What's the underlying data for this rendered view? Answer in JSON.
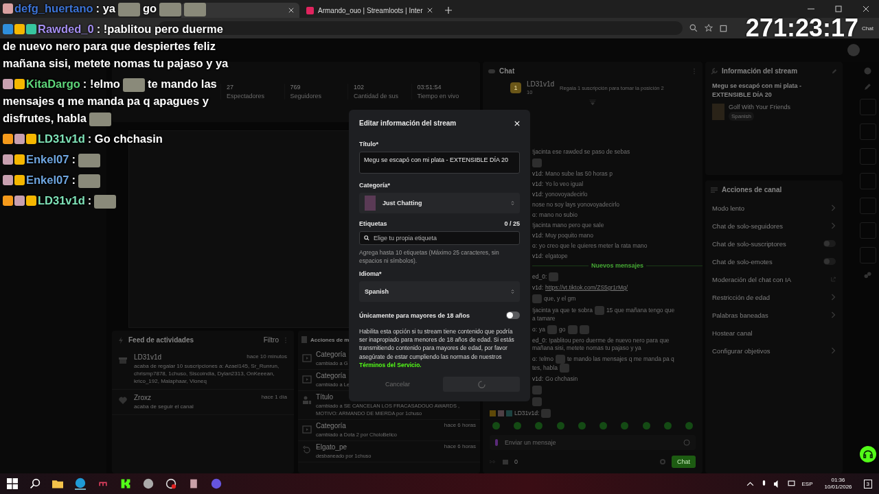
{
  "browser": {
    "tabs": [
      {
        "kind": "kick",
        "selected": true
      },
      {
        "kind": "loots",
        "title": "Armando_ouo | Streamloots | Inter",
        "selected": false
      }
    ],
    "extension_label": "Chat"
  },
  "overlay": {
    "timer": "271:23:17",
    "messages": [
      {
        "user": "defg_huertano",
        "color": "#3d74d6",
        "badges": [
          {
            "kind": "avatar"
          }
        ],
        "parts": [
          {
            "kind": "text",
            "text": ": ya"
          },
          {
            "kind": "emote"
          },
          {
            "kind": "text",
            "text": "go"
          },
          {
            "kind": "emote"
          },
          {
            "kind": "emote"
          }
        ]
      },
      {
        "user": "Rawded_0",
        "color": "#a48ef0",
        "badges": [
          {
            "kind": "hammer"
          },
          {
            "kind": "sub"
          },
          {
            "kind": "gg"
          }
        ],
        "parts": [
          {
            "kind": "text",
            "text": ": !pablitou pero duerme"
          },
          {
            "kind": "text",
            "text": "de nuevo nero para que despiertes feliz",
            "br": true
          },
          {
            "kind": "text",
            "text": "mañana sisi, metete nomas tu pajaso y ya",
            "br": true
          }
        ]
      },
      {
        "user": "KitaDargo",
        "color": "#5ed67a",
        "badges": [
          {
            "kind": "bot"
          },
          {
            "kind": "crown"
          }
        ],
        "parts": [
          {
            "kind": "text",
            "text": ": !elmo"
          },
          {
            "kind": "emote"
          },
          {
            "kind": "text",
            "text": "te mando las"
          },
          {
            "kind": "text",
            "text": "mensajes q me manda pa q apagues y",
            "br": true
          },
          {
            "kind": "text",
            "text": "disfrutes, habla",
            "br": true
          },
          {
            "kind": "emote"
          }
        ]
      },
      {
        "user": "LD31v1d",
        "color": "#7fe3b8",
        "badges": [
          {
            "kind": "box"
          },
          {
            "kind": "bot"
          },
          {
            "kind": "crown"
          }
        ],
        "parts": [
          {
            "kind": "text",
            "text": ": Go chchasin"
          }
        ]
      },
      {
        "user": "Enkel07",
        "color": "#6fa6e0",
        "badges": [
          {
            "kind": "bot"
          },
          {
            "kind": "crown"
          }
        ],
        "parts": [
          {
            "kind": "text",
            "text": ":"
          },
          {
            "kind": "emote"
          }
        ]
      },
      {
        "user": "Enkel07",
        "color": "#6fa6e0",
        "badges": [
          {
            "kind": "bot"
          },
          {
            "kind": "crown"
          }
        ],
        "parts": [
          {
            "kind": "text",
            "text": ":"
          },
          {
            "kind": "emote"
          }
        ]
      },
      {
        "user": "LD31v1d",
        "color": "#7fe3b8",
        "badges": [
          {
            "kind": "box"
          },
          {
            "kind": "bot"
          },
          {
            "kind": "crown"
          }
        ],
        "parts": [
          {
            "kind": "text",
            "text": ":"
          },
          {
            "kind": "emote"
          }
        ]
      }
    ]
  },
  "session": {
    "stats": [
      {
        "value": "27",
        "label": "Espectadores"
      },
      {
        "value": "769",
        "label": "Seguidores"
      },
      {
        "value": "102",
        "label": "Cantidad de sus"
      },
      {
        "value": "03:51:54",
        "label": "Tiempo en vivo"
      }
    ]
  },
  "activity_feed": {
    "title": "Feed de actividades",
    "filter": "Filtro",
    "items": [
      {
        "kind": "gift",
        "user": "LD31v1d",
        "time": "hace 10 minutos",
        "text": "acaba de regalar 10 suscripciones a: Azael145, Sr_Runrun, chrismp7878, 1chuso, Siscoindia, Dylan2313, OnKeeean, krico_192, Malaphaar, Vloneq"
      },
      {
        "kind": "follow",
        "user": "Zroxz",
        "time": "hace 1 día",
        "text": "acaba de seguir el canal"
      }
    ]
  },
  "mod_actions": {
    "title": "Acciones de m",
    "items": [
      {
        "kind": "category",
        "label": "Categoría",
        "text": "cambiado a G"
      },
      {
        "kind": "category",
        "label": "Categoría",
        "text": "cambiado a Le"
      },
      {
        "kind": "title",
        "label": "Título",
        "text": "cambiado a SE CANCELAN LOS FRACASADOUO AWARDS , MOTIVO: ARMANDO DE MIERDA por 1chuso"
      },
      {
        "kind": "category",
        "label": "Categoría",
        "text": "cambiado a Dota 2 por CholoBelico",
        "time": "hace 6 horas"
      },
      {
        "kind": "unban",
        "label": "Elgato_pe",
        "text": "desbaneado por 1chuso",
        "time": "hace 6 horas"
      }
    ]
  },
  "chat": {
    "title": "Chat",
    "pinned": {
      "rank": "1",
      "user": "LD31v1d",
      "count": "10",
      "text": "Regala 1 suscripción para tomar la posición 2"
    },
    "messages": [
      {
        "kind": "message",
        "parts": [
          {
            "kind": "text",
            "text": "!jacinta ese rawded se paso de sebas"
          }
        ]
      },
      {
        "kind": "message",
        "parts": [
          {
            "kind": "emote"
          }
        ]
      },
      {
        "kind": "message",
        "name": "v1d:",
        "parts": [
          {
            "kind": "text",
            "text": "Mano sube las 50 horas p"
          }
        ]
      },
      {
        "kind": "message",
        "name": "v1d:",
        "parts": [
          {
            "kind": "text",
            "text": "Yo lo veo igual"
          }
        ]
      },
      {
        "kind": "message",
        "name": "v1d:",
        "parts": [
          {
            "kind": "text",
            "text": "yonovoyadecirlo"
          }
        ]
      },
      {
        "kind": "message",
        "parts": [
          {
            "kind": "text",
            "text": "nose no soy lays yonovoyadecirlo"
          }
        ]
      },
      {
        "kind": "message",
        "name": "o:",
        "parts": [
          {
            "kind": "text",
            "text": "mano no subio"
          }
        ]
      },
      {
        "kind": "message",
        "parts": [
          {
            "kind": "text",
            "text": "!jacinta mano pero que sale"
          }
        ]
      },
      {
        "kind": "message",
        "name": "v1d:",
        "parts": [
          {
            "kind": "text",
            "text": "Muy poquito mano"
          }
        ]
      },
      {
        "kind": "message",
        "name": "o:",
        "parts": [
          {
            "kind": "text",
            "text": "yo creo que le quieres meter la rata mano"
          }
        ]
      },
      {
        "kind": "message",
        "name": "v1d:",
        "parts": [
          {
            "kind": "text",
            "text": "elgatope"
          }
        ]
      },
      {
        "kind": "divider",
        "text": "Nuevos mensajes"
      },
      {
        "kind": "message",
        "name": "ed_0:",
        "parts": [
          {
            "kind": "emote"
          }
        ]
      },
      {
        "kind": "message",
        "name": "v1d:",
        "parts": [
          {
            "kind": "link",
            "text": "https://vt.tiktok.com/ZS5gr1rMq/"
          }
        ]
      },
      {
        "kind": "message",
        "parts": [
          {
            "kind": "emote"
          },
          {
            "kind": "text",
            "text": "que, y el gm"
          }
        ]
      },
      {
        "kind": "message",
        "parts": [
          {
            "kind": "text",
            "text": "!jacinta ya que te sobra"
          },
          {
            "kind": "emote"
          },
          {
            "kind": "text",
            "text": "15 que mañana tengo que"
          },
          {
            "kind": "text",
            "text": "a tamare",
            "br": true
          }
        ]
      },
      {
        "kind": "message",
        "name": "o:",
        "parts": [
          {
            "kind": "text",
            "text": "ya"
          },
          {
            "kind": "emote"
          },
          {
            "kind": "text",
            "text": "go"
          },
          {
            "kind": "emote"
          },
          {
            "kind": "emote"
          }
        ]
      },
      {
        "kind": "message",
        "name": "ed_0:",
        "parts": [
          {
            "kind": "text",
            "text": "!pablitou pero duerme de nuevo nero para que"
          },
          {
            "kind": "text",
            "text": "mañana sisi, metete nomas tu pajaso y ya",
            "br": true
          }
        ]
      },
      {
        "kind": "message",
        "name": "o:",
        "parts": [
          {
            "kind": "text",
            "text": "!elmo"
          },
          {
            "kind": "emote"
          },
          {
            "kind": "text",
            "text": "te mando las mensajes q me manda pa q"
          },
          {
            "kind": "text",
            "text": "tes, habla",
            "br": true
          },
          {
            "kind": "emote"
          }
        ]
      },
      {
        "kind": "message",
        "name": "v1d:",
        "parts": [
          {
            "kind": "text",
            "text": "Go chchasin"
          }
        ]
      },
      {
        "kind": "message",
        "parts": [
          {
            "kind": "emote"
          }
        ]
      },
      {
        "kind": "message",
        "parts": [
          {
            "kind": "emote"
          }
        ]
      },
      {
        "kind": "message",
        "badges": [
          {
            "kind": "crown"
          },
          {
            "kind": "bot"
          },
          {
            "kind": "gift"
          }
        ],
        "name": "LD31v1d:",
        "parts": [
          {
            "kind": "emote"
          }
        ]
      }
    ],
    "input_placeholder": "Enviar un mensaje",
    "coins": "0",
    "send": "Chat"
  },
  "stream_info": {
    "title": "Información del stream",
    "stream_title": "Megu se escapó con mi plata - EXTENSIBLE DÍA 20",
    "category": "Golf With Your Friends",
    "tag": "Spanish"
  },
  "channel_actions": {
    "title": "Acciones de canal",
    "items": [
      {
        "kind": "chevron",
        "label": "Modo lento"
      },
      {
        "kind": "chevron",
        "label": "Chat de solo-seguidores"
      },
      {
        "kind": "toggle",
        "label": "Chat de solo-suscriptores",
        "on": false
      },
      {
        "kind": "toggle",
        "label": "Chat de solo-emotes",
        "on": false
      },
      {
        "kind": "external",
        "label": "Moderación del chat con IA"
      },
      {
        "kind": "chevron",
        "label": "Restricción de edad"
      },
      {
        "kind": "chevron",
        "label": "Palabras baneadas"
      },
      {
        "kind": "plain",
        "label": "Hostear canal"
      },
      {
        "kind": "chevron",
        "label": "Configurar objetivos"
      }
    ]
  },
  "modal": {
    "title": "Editar información del stream",
    "title_label": "Título*",
    "title_value": "Megu se escapó con mi plata - EXTENSIBLE DÍA 20",
    "category_label": "Categoría*",
    "category": "Just Chatting",
    "tags_label": "Etiquetas",
    "tags_count": "0 / 25",
    "tags_placeholder": "Elige tu propia etiqueta",
    "tags_help": "Agrega hasta 10 etiquetas (Máximo 25 caracteres, sin espacios ni símbolos).",
    "language_label": "Idioma*",
    "language": "Spanish",
    "mature_label": "Únicamente para mayores de 18 años",
    "mature_on": false,
    "mature_help": "Habilita esta opción si tu stream tiene contenido que podría ser inapropiado para menores de 18 años de edad. Si estás transmitiendo contenido para mayores de edad, por favor asegúrate de estar cumpliendo las normas de nuestros",
    "terms_link": "Términos del Servicio.",
    "cancel": "Cancelar",
    "saving": true
  },
  "taskbar": {
    "lang": "ESP",
    "time": "01:36",
    "date": "10/01/2026",
    "notifications": "3"
  }
}
